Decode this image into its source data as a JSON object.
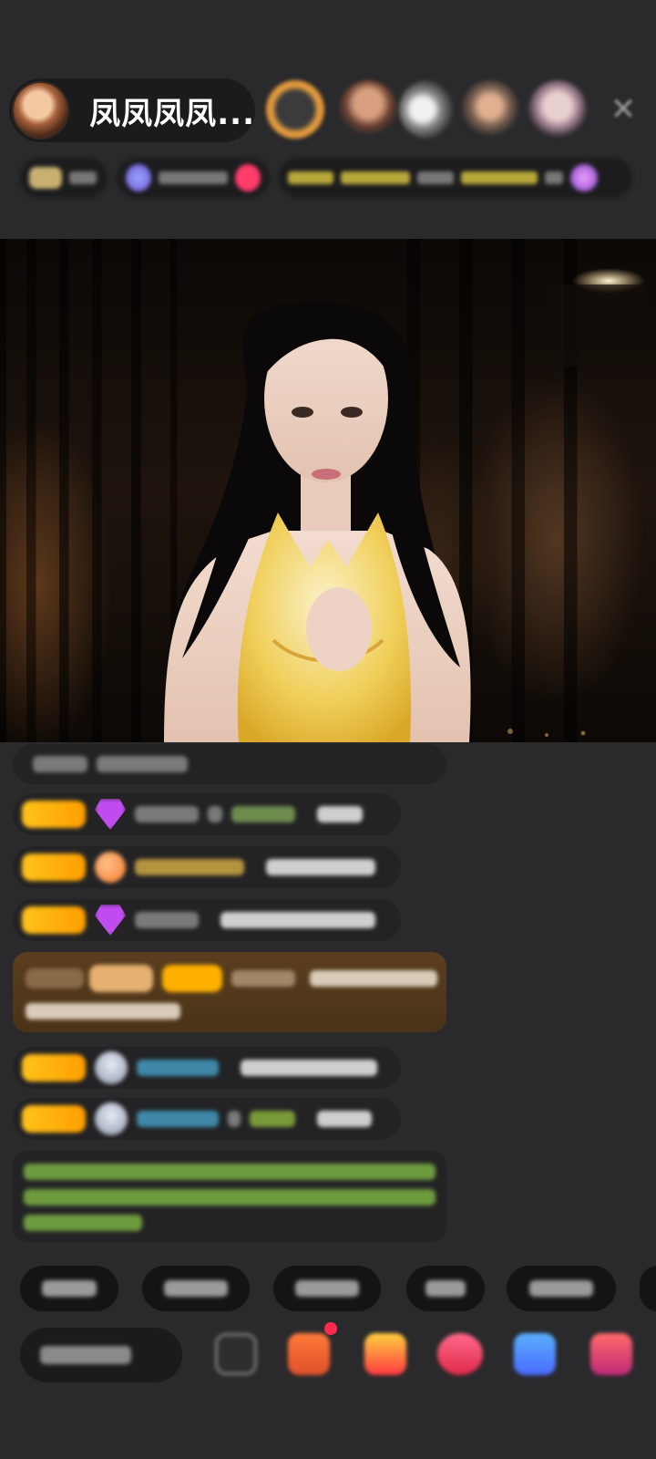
{
  "host": {
    "name": "凤凤凤凤..."
  },
  "header": {
    "close_icon": "close-icon",
    "viewer_avatars": [
      "viewer-avatar",
      "viewer-avatar",
      "viewer-avatar",
      "viewer-avatar",
      "viewer-avatar"
    ]
  },
  "colors": {
    "background": "#2a2a2c",
    "badge": "#ffc21a",
    "gift_card": "#5a3e1e",
    "system_text": "#6e9a3e"
  }
}
